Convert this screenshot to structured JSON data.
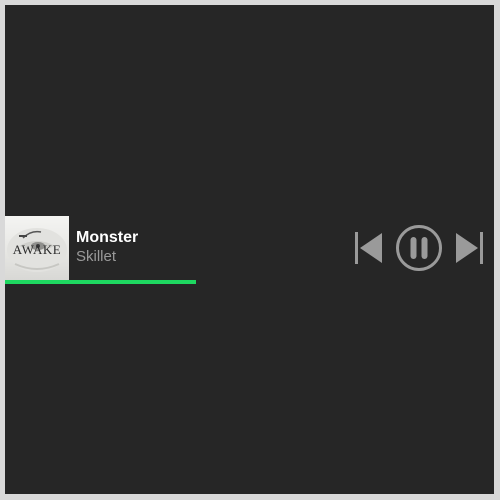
{
  "track": {
    "title": "Monster",
    "artist": "Skillet"
  },
  "album": {
    "art_text": "AWAKE"
  },
  "progress": {
    "fraction": 0.39
  },
  "controls": {
    "previous_icon": "skip-previous-icon",
    "play_pause_icon": "pause-circle-icon",
    "next_icon": "skip-next-icon"
  },
  "colors": {
    "background": "#262626",
    "progress": "#1ed760",
    "title": "#ffffff",
    "artist": "#9a9a9a",
    "controls": "#9a9a9a"
  }
}
